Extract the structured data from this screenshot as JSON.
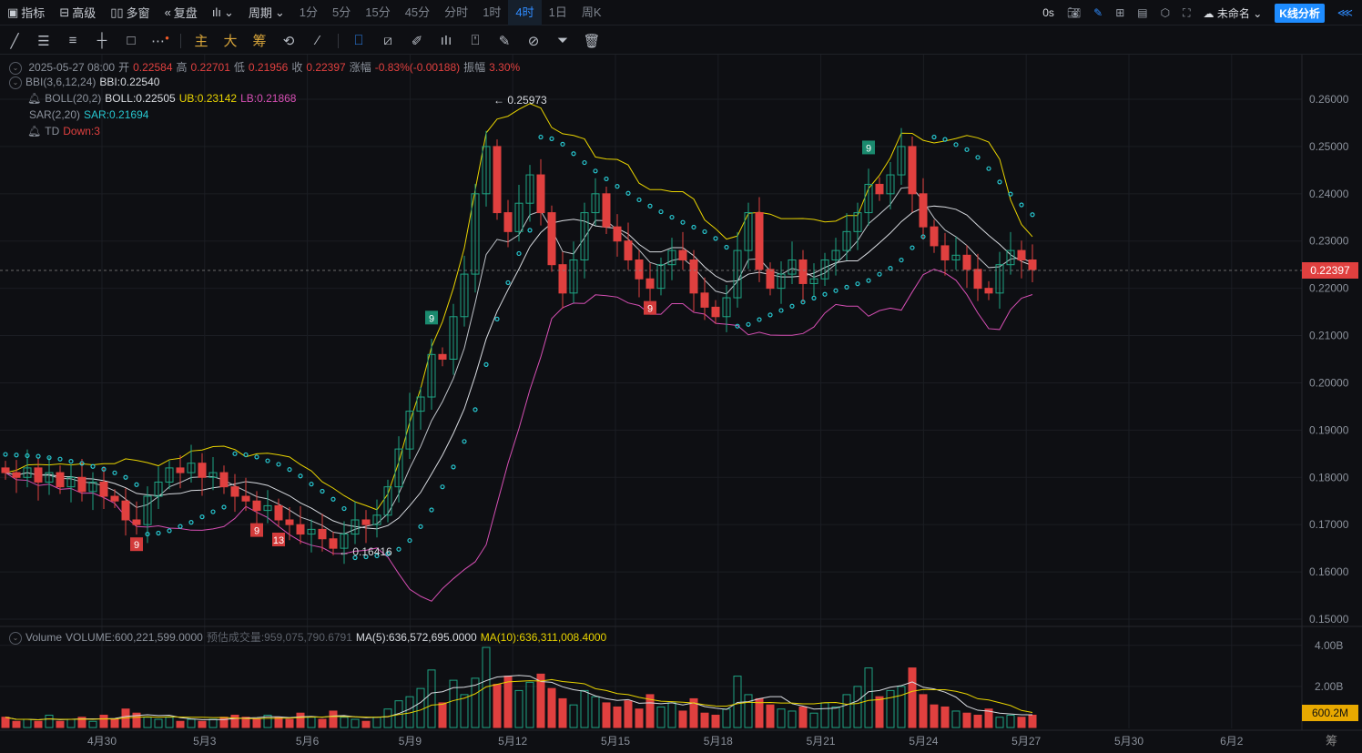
{
  "topbar": {
    "indicators": "指标",
    "advanced": "高级",
    "multi": "多窗",
    "replay": "复盘",
    "period": "周期",
    "periods": [
      "1分",
      "5分",
      "15分",
      "45分",
      "分时",
      "1时",
      "4时",
      "1日",
      "周K"
    ],
    "active_period": "4时",
    "countdown": "0s",
    "layout_name": "未命名",
    "analysis_btn": "K线分析"
  },
  "toolbar2": {
    "main": "主",
    "big": "大",
    "chips": "筹"
  },
  "legend": {
    "ohlc": {
      "time": "2025-05-27 08:00",
      "open_l": "开",
      "open": "0.22584",
      "high_l": "高",
      "high": "0.22701",
      "low_l": "低",
      "low": "0.21956",
      "close_l": "收",
      "close": "0.22397",
      "chg_l": "涨幅",
      "chg": "-0.83%(-0.00188)",
      "amp_l": "振幅",
      "amp": "3.30%"
    },
    "bbi": {
      "name": "BBI(3,6,12,24)",
      "value": "BBI:0.22540"
    },
    "boll": {
      "name": "BOLL(20,2)",
      "mid": "BOLL:0.22505",
      "ub": "UB:0.23142",
      "lb": "LB:0.21868"
    },
    "sar": {
      "name": "SAR(2,20)",
      "value": "SAR:0.21694"
    },
    "td": {
      "name": "TD",
      "value": "Down:3"
    },
    "volume": {
      "name": "Volume",
      "value": "VOLUME:600,221,599.0000",
      "est": "预估成交量:959,075,790.6791",
      "ma5": "MA(5):636,572,695.0000",
      "ma10": "MA(10):636,311,008.4000"
    }
  },
  "colors": {
    "up": "#1fa383",
    "down": "#e0403f",
    "ub": "#e8d300",
    "lb": "#d64fb4",
    "mid": "#d8dbe0",
    "sar": "#27c7d0",
    "bg": "#0e0f13"
  },
  "chart_data": {
    "type": "candlestick",
    "ylim": [
      0.15,
      0.26
    ],
    "yticks": [
      "0.26000",
      "0.25000",
      "0.24000",
      "0.23000",
      "0.22000",
      "0.21000",
      "0.20000",
      "0.19000",
      "0.18000",
      "0.17000",
      "0.16000",
      "0.15000"
    ],
    "xticks": [
      "4月30",
      "5月3",
      "5月6",
      "5月9",
      "5月12",
      "5月15",
      "5月18",
      "5月21",
      "5月24",
      "5月27",
      "5月30",
      "6月2"
    ],
    "last_price": "0.22397",
    "annotations": {
      "max": "0.25973",
      "min": "0.16416"
    },
    "td_marks": [
      {
        "i": 12,
        "label": "9",
        "type": "down"
      },
      {
        "i": 23,
        "label": "9",
        "type": "down"
      },
      {
        "i": 25,
        "label": "13",
        "type": "down"
      },
      {
        "i": 39,
        "label": "9",
        "type": "up"
      },
      {
        "i": 59,
        "label": "9",
        "type": "down"
      },
      {
        "i": 79,
        "label": "9",
        "type": "up"
      }
    ],
    "closes": [
      0.181,
      0.18,
      0.182,
      0.179,
      0.181,
      0.178,
      0.18,
      0.177,
      0.179,
      0.176,
      0.175,
      0.171,
      0.17,
      0.176,
      0.179,
      0.182,
      0.181,
      0.183,
      0.18,
      0.181,
      0.178,
      0.176,
      0.175,
      0.173,
      0.174,
      0.171,
      0.17,
      0.168,
      0.169,
      0.167,
      0.165,
      0.168,
      0.171,
      0.17,
      0.172,
      0.178,
      0.186,
      0.194,
      0.197,
      0.206,
      0.205,
      0.214,
      0.223,
      0.24,
      0.25,
      0.236,
      0.232,
      0.238,
      0.244,
      0.236,
      0.225,
      0.219,
      0.226,
      0.236,
      0.24,
      0.233,
      0.23,
      0.226,
      0.222,
      0.22,
      0.225,
      0.228,
      0.226,
      0.219,
      0.216,
      0.214,
      0.218,
      0.228,
      0.236,
      0.224,
      0.22,
      0.223,
      0.226,
      0.221,
      0.222,
      0.226,
      0.228,
      0.232,
      0.236,
      0.242,
      0.24,
      0.244,
      0.25,
      0.24,
      0.233,
      0.229,
      0.226,
      0.227,
      0.224,
      0.22,
      0.219,
      0.225,
      0.228,
      0.226,
      0.22397
    ],
    "volume_ylim": [
      0,
      4.3
    ],
    "volume_yticks": [
      "4.00B",
      "2.00B"
    ],
    "last_volume": "600.2M",
    "volumes_b": [
      0.5,
      0.3,
      0.4,
      0.3,
      0.6,
      0.3,
      0.4,
      0.5,
      0.3,
      0.6,
      0.4,
      0.9,
      0.7,
      0.5,
      0.4,
      0.5,
      0.3,
      0.4,
      0.3,
      0.4,
      0.5,
      0.6,
      0.5,
      0.4,
      0.6,
      0.5,
      0.4,
      0.7,
      0.5,
      0.4,
      0.8,
      0.5,
      0.4,
      0.3,
      0.5,
      0.9,
      1.3,
      1.5,
      1.9,
      2.8,
      1.2,
      2.3,
      1.6,
      2.4,
      3.9,
      2.1,
      2.5,
      1.8,
      2.2,
      2.6,
      1.9,
      1.4,
      1.1,
      1.8,
      1.5,
      1.2,
      1.0,
      1.3,
      0.9,
      1.6,
      1.0,
      1.2,
      0.8,
      1.4,
      0.7,
      0.6,
      0.9,
      2.5,
      1.6,
      1.4,
      1.1,
      0.9,
      0.8,
      1.0,
      0.7,
      1.2,
      1.0,
      1.6,
      2.0,
      2.9,
      1.5,
      1.8,
      2.0,
      2.9,
      1.6,
      1.1,
      1.0,
      0.8,
      0.7,
      0.6,
      0.9,
      0.5,
      0.6,
      0.5,
      0.6
    ]
  }
}
